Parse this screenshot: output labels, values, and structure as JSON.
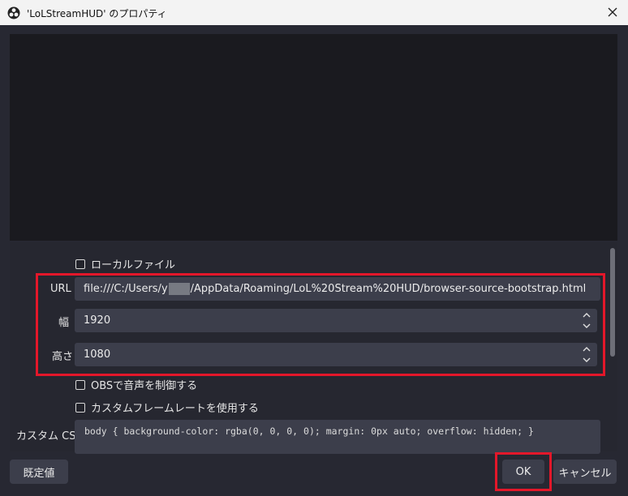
{
  "window": {
    "title": "'LoLStreamHUD' のプロパティ"
  },
  "properties": {
    "local_file_label": "ローカルファイル",
    "url_label": "URL",
    "url_prefix": "file:///C:/Users/y",
    "url_suffix": "/AppData/Roaming/LoL%20Stream%20HUD/browser-source-bootstrap.html",
    "width_label": "幅",
    "width_value": "1920",
    "height_label": "高さ",
    "height_value": "1080",
    "obs_audio_label": "OBSで音声を制御する",
    "custom_framerate_label": "カスタムフレームレートを使用する",
    "custom_css_label": "カスタム CSS",
    "custom_css_value": "body { background-color: rgba(0, 0, 0, 0); margin: 0px auto; overflow: hidden; }"
  },
  "footer": {
    "defaults_label": "既定値",
    "ok_label": "OK",
    "cancel_label": "キャンセル"
  },
  "colors": {
    "highlight": "#e3172a",
    "background": "#272832",
    "field": "#3c3e4b"
  }
}
